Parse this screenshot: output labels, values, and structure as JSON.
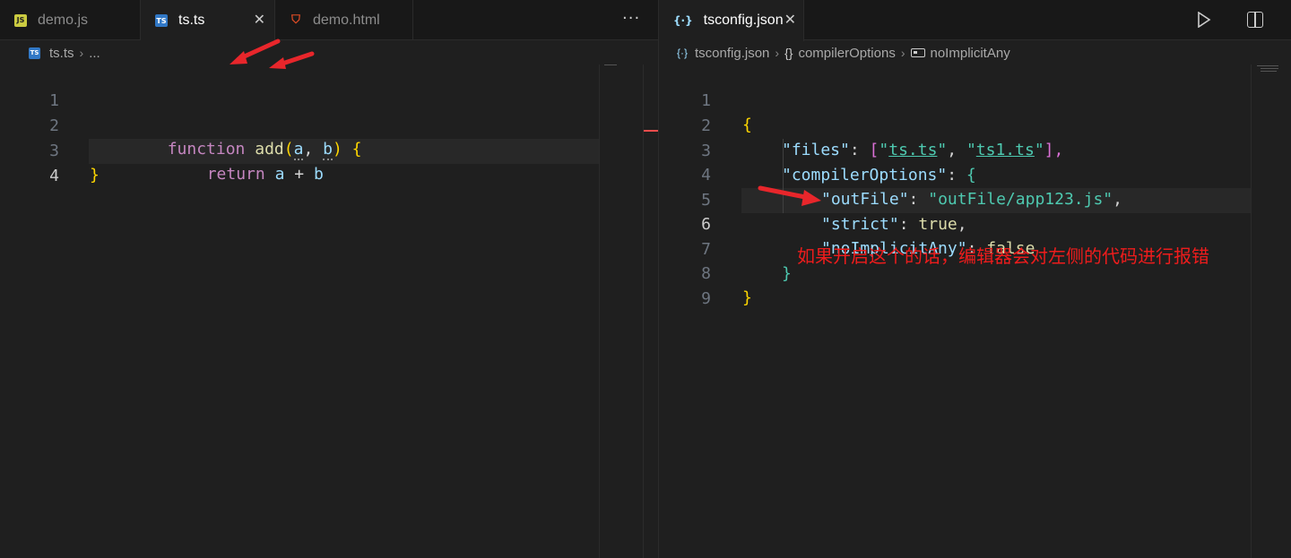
{
  "left": {
    "tabs": [
      {
        "name": "demo.js",
        "icon": "js-file-icon",
        "active": false
      },
      {
        "name": "ts.ts",
        "icon": "ts-file-icon",
        "active": true
      },
      {
        "name": "demo.html",
        "icon": "html-file-icon",
        "active": false
      }
    ],
    "tab_close": "✕",
    "more": "···",
    "breadcrumb": {
      "file": "ts.ts",
      "rest": "..."
    },
    "line_numbers": [
      "1",
      "2",
      "3",
      "4"
    ],
    "code": {
      "l1": {
        "kw": "function",
        "fn": "add",
        "open": "(",
        "a": "a",
        "comma": ",",
        "b": "b",
        "close": ")",
        "brace": "{"
      },
      "l2": {
        "kw": "return",
        "a": "a",
        "op": "+",
        "b": "b"
      },
      "l3": {
        "brace": "}"
      }
    }
  },
  "right": {
    "tab": {
      "name": "tsconfig.json",
      "icon": "json-file-icon",
      "close": "✕"
    },
    "breadcrumb": {
      "file": "tsconfig.json",
      "obj": "compilerOptions",
      "prop": "noImplicitAny"
    },
    "line_numbers": [
      "1",
      "2",
      "3",
      "4",
      "5",
      "6",
      "7",
      "8",
      "9"
    ],
    "code": {
      "l1": "{",
      "l2": {
        "key": "\"files\"",
        "colon": ":",
        "open": "[",
        "s1": "ts.ts",
        "s2": "ts1.ts",
        "close": "],"
      },
      "l3": {
        "key": "\"compilerOptions\"",
        "colon": ":",
        "brace": "{"
      },
      "l4": {
        "key": "\"outFile\"",
        "colon": ":",
        "val": "\"outFile/app123.js\"",
        "comma": ","
      },
      "l5": {
        "key": "\"strict\"",
        "colon": ":",
        "val": "true",
        "comma": ","
      },
      "l6": {
        "key": "\"noImplicitAny\"",
        "colon": ":",
        "val": "false"
      },
      "l7": "}",
      "l8": "}"
    }
  },
  "annotation": "如果开启这个的话，编辑器会对左侧的代码进行报错",
  "colors": {
    "arrow": "#e8262b",
    "annotation": "#ee1c1c",
    "active_tab_border": "#0078d4"
  }
}
